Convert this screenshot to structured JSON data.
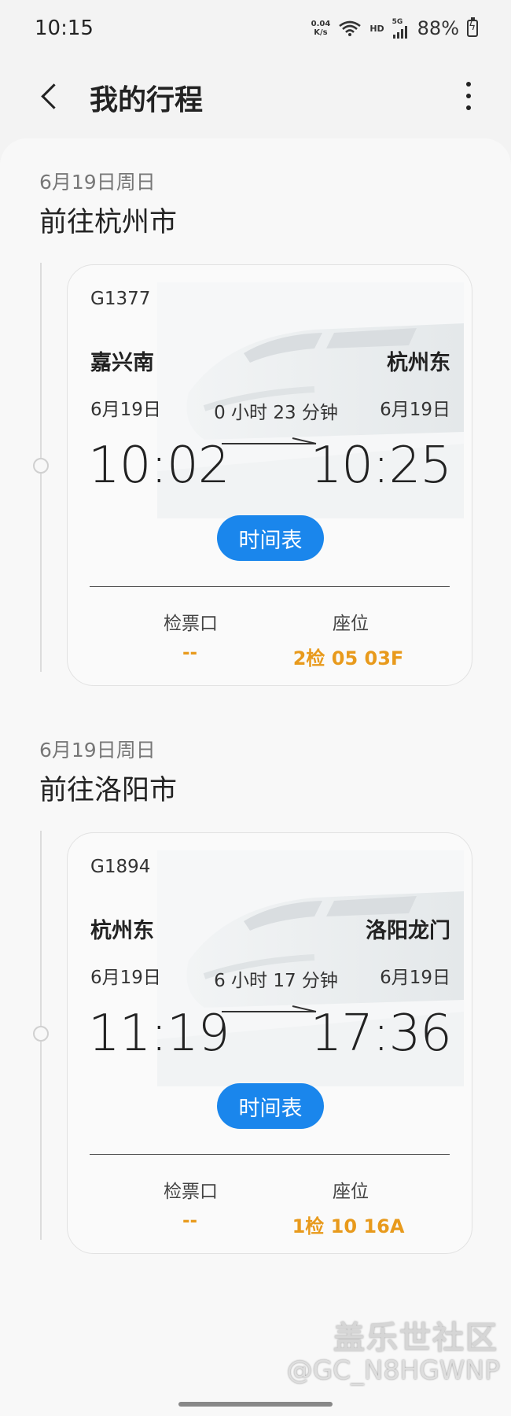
{
  "status_bar": {
    "time": "10:15",
    "net_speed_value": "0.04",
    "net_speed_unit": "K/s",
    "hd": "HD",
    "network": "5G",
    "battery": "88%"
  },
  "header": {
    "title": "我的行程"
  },
  "trips": [
    {
      "date": "6月19日周日",
      "destination": "前往杭州市",
      "train_no": "G1377",
      "from_station": "嘉兴南",
      "to_station": "杭州东",
      "from_date": "6月19日",
      "to_date": "6月19日",
      "duration": "0 小时 23 分钟",
      "from_time": "10:02",
      "to_time": "10:25",
      "schedule_label": "时间表",
      "gate_label": "检票口",
      "gate_value": "--",
      "seat_label": "座位",
      "seat_value": "2检 05 03F"
    },
    {
      "date": "6月19日周日",
      "destination": "前往洛阳市",
      "train_no": "G1894",
      "from_station": "杭州东",
      "to_station": "洛阳龙门",
      "from_date": "6月19日",
      "to_date": "6月19日",
      "duration": "6 小时 17 分钟",
      "from_time": "11:19",
      "to_time": "17:36",
      "schedule_label": "时间表",
      "gate_label": "检票口",
      "gate_value": "--",
      "seat_label": "座位",
      "seat_value": "1检 10 16A"
    }
  ],
  "watermark": {
    "line1": "盖乐世社区",
    "line2": "@GC_N8HGWNP"
  },
  "colors": {
    "accent_blue": "#1a86ec",
    "seat_orange": "#e89a1c"
  }
}
